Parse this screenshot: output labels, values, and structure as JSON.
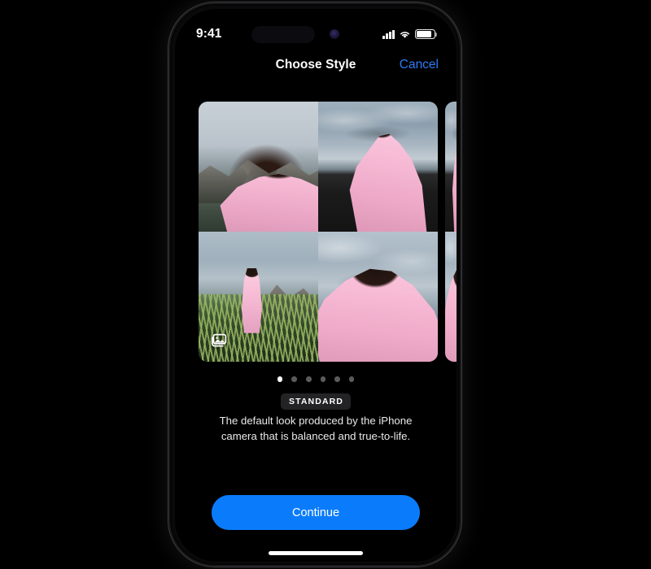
{
  "status_bar": {
    "time": "9:41",
    "cellular_icon": "cellular-bars-icon",
    "wifi_icon": "wifi-icon",
    "battery_icon": "battery-icon",
    "dynamic_island": "dynamic-island",
    "camera_indicator": "camera-active-dot"
  },
  "nav": {
    "title": "Choose Style",
    "cancel_label": "Cancel",
    "cancel_color": "#2f7cf6"
  },
  "carousel": {
    "photo_stack_icon": "photo-stack-icon",
    "cards": [
      {
        "style_name": "STANDARD",
        "photos": [
          "portrait-closeup-mountains",
          "figure-black-sand-beach",
          "wide-shot-grassy-dune",
          "portrait-profile-cloudy-sky"
        ]
      }
    ],
    "peek_card": "next-style-preview"
  },
  "pagination": {
    "total": 6,
    "active_index": 0
  },
  "style_info": {
    "badge": "STANDARD",
    "description": "The default look produced by the iPhone camera that is balanced and true-to-life."
  },
  "actions": {
    "continue_label": "Continue",
    "continue_color": "#0a7cfb"
  },
  "home_indicator": "home-indicator"
}
